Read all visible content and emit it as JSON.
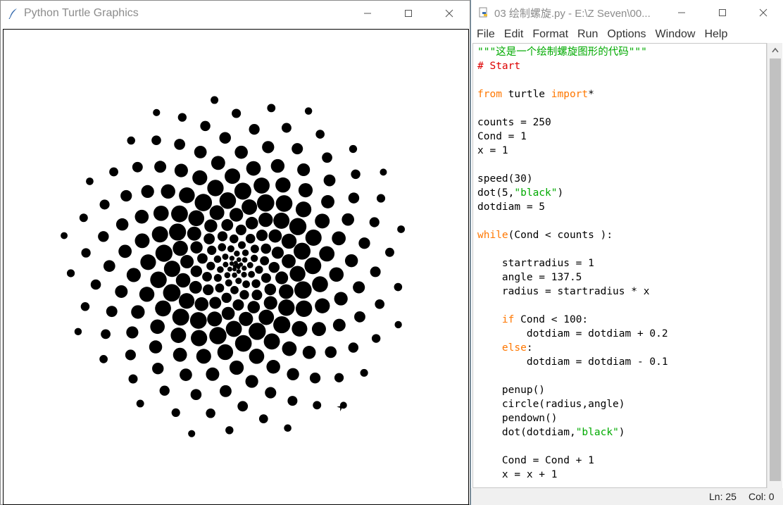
{
  "turtle_window": {
    "title": "Python Turtle Graphics",
    "dot_count": 250,
    "dot_color": "#000000",
    "angle": 137.5
  },
  "idle_window": {
    "title": "03 绘制螺旋.py - E:\\Z Seven\\00...",
    "menu": [
      "File",
      "Edit",
      "Format",
      "Run",
      "Options",
      "Window",
      "Help"
    ],
    "code_lines": [
      [
        {
          "t": "\"\"\"这是一个绘制螺旋图形的代码\"\"\"",
          "c": "str"
        }
      ],
      [
        {
          "t": "# Start",
          "c": "cmt"
        }
      ],
      [],
      [
        {
          "t": "from",
          "c": "kw"
        },
        {
          "t": " turtle ",
          "c": ""
        },
        {
          "t": "import",
          "c": "kw"
        },
        {
          "t": "*",
          "c": ""
        }
      ],
      [],
      [
        {
          "t": "counts = 250",
          "c": ""
        }
      ],
      [
        {
          "t": "Cond = 1",
          "c": ""
        }
      ],
      [
        {
          "t": "x = 1",
          "c": ""
        }
      ],
      [],
      [
        {
          "t": "speed(30)",
          "c": ""
        }
      ],
      [
        {
          "t": "dot(5,",
          "c": ""
        },
        {
          "t": "\"black\"",
          "c": "str"
        },
        {
          "t": ")",
          "c": ""
        }
      ],
      [
        {
          "t": "dotdiam = 5",
          "c": ""
        }
      ],
      [],
      [
        {
          "t": "while",
          "c": "kw"
        },
        {
          "t": "(Cond < counts ):",
          "c": ""
        }
      ],
      [],
      [
        {
          "t": "    startradius = 1",
          "c": ""
        }
      ],
      [
        {
          "t": "    angle = 137.5",
          "c": ""
        }
      ],
      [
        {
          "t": "    radius = startradius * x",
          "c": ""
        }
      ],
      [],
      [
        {
          "t": "    ",
          "c": ""
        },
        {
          "t": "if",
          "c": "kw"
        },
        {
          "t": " Cond < 100:",
          "c": ""
        }
      ],
      [
        {
          "t": "        dotdiam = dotdiam + 0.2",
          "c": ""
        }
      ],
      [
        {
          "t": "    ",
          "c": ""
        },
        {
          "t": "else",
          "c": "kw"
        },
        {
          "t": ":",
          "c": ""
        }
      ],
      [
        {
          "t": "        dotdiam = dotdiam - 0.1",
          "c": ""
        }
      ],
      [],
      [
        {
          "t": "    penup()",
          "c": ""
        }
      ],
      [
        {
          "t": "    circle(radius,angle)",
          "c": ""
        }
      ],
      [
        {
          "t": "    pendown()",
          "c": ""
        }
      ],
      [
        {
          "t": "    dot(dotdiam,",
          "c": ""
        },
        {
          "t": "\"black\"",
          "c": "str"
        },
        {
          "t": ")",
          "c": ""
        }
      ],
      [],
      [
        {
          "t": "    Cond = Cond + 1",
          "c": ""
        }
      ],
      [
        {
          "t": "    x = x + 1",
          "c": ""
        }
      ]
    ],
    "status": {
      "ln": "Ln: 25",
      "col": "Col: 0"
    }
  },
  "colors": {
    "keyword": "#ff7700",
    "string": "#00aa00",
    "comment": "#dd0000"
  }
}
